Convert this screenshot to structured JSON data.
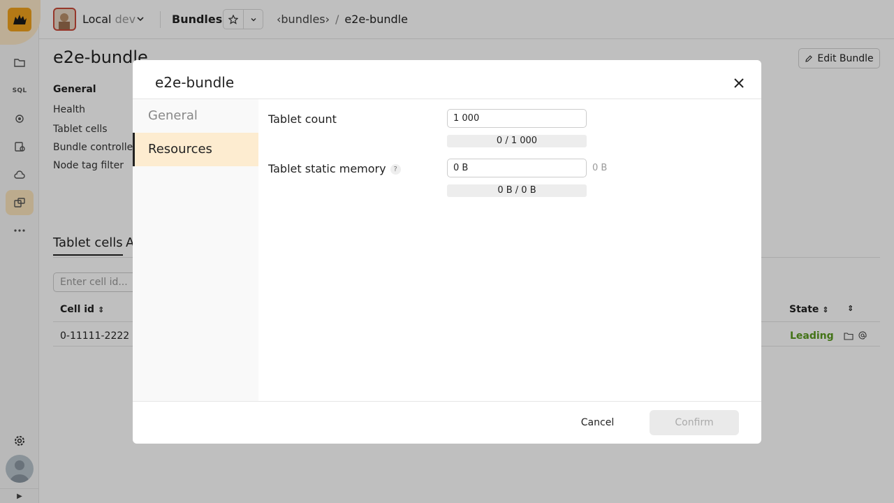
{
  "header": {
    "cluster_name": "Local",
    "cluster_env": "dev",
    "page_name": "Bundles",
    "breadcrumb_link": "‹bundles›",
    "breadcrumb_sep": "/",
    "breadcrumb_current": "e2e-bundle"
  },
  "sidebar": {
    "sql_label": "SQL"
  },
  "page": {
    "title": "e2e-bundle",
    "edit_button": "Edit Bundle",
    "general_heading": "General",
    "general_items": [
      "Health",
      "Tablet cells",
      "Bundle controller",
      "Node tag filter"
    ],
    "tabs": [
      "Tablet cells",
      "A"
    ],
    "cell_search_placeholder": "Enter cell id...",
    "columns": {
      "cell_id": "Cell id",
      "state": "State"
    },
    "rows": [
      {
        "cell_id": "0-11111-2222",
        "state": "Leading"
      }
    ]
  },
  "modal": {
    "title": "e2e-bundle",
    "nav": [
      "General",
      "Resources"
    ],
    "active_nav": "Resources",
    "fields": [
      {
        "label": "Tablet count",
        "value": "1 000",
        "usage": "0 / 1 000",
        "suffix": ""
      },
      {
        "label": "Tablet static memory",
        "value": "0 B",
        "usage": "0 B / 0 B",
        "suffix": "0 B",
        "help": "?"
      }
    ],
    "cancel_label": "Cancel",
    "confirm_label": "Confirm"
  },
  "colors": {
    "accent": "#f0a21c",
    "active_nav_bg": "#fdecd0",
    "state_ok": "#5a9a1f"
  }
}
